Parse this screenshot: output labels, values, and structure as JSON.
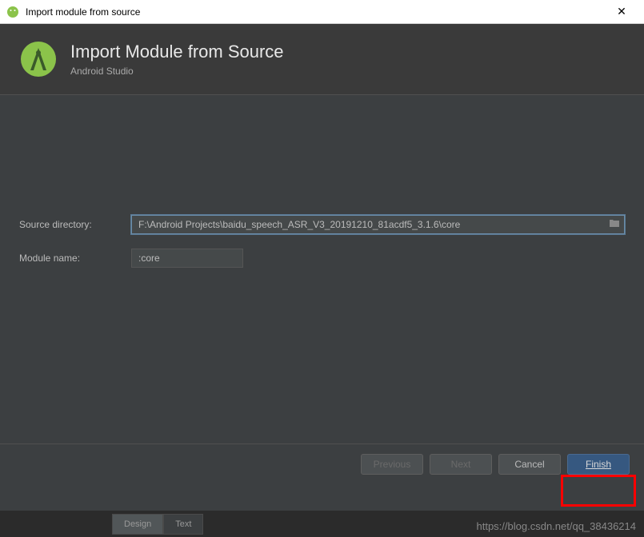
{
  "titlebar": {
    "title": "Import module from source",
    "close": "✕"
  },
  "header": {
    "title": "Import Module from Source",
    "subtitle": "Android Studio"
  },
  "form": {
    "source_dir_label": "Source directory:",
    "source_dir_value": "F:\\Android Projects\\baidu_speech_ASR_V3_20191210_81acdf5_3.1.6\\core",
    "module_name_label": "Module name:",
    "module_name_value": ":core"
  },
  "buttons": {
    "previous": "Previous",
    "next": "Next",
    "cancel": "Cancel",
    "finish": "Finish"
  },
  "tabs": {
    "design": "Design",
    "text": "Text"
  },
  "watermark": "https://blog.csdn.net/qq_38436214"
}
